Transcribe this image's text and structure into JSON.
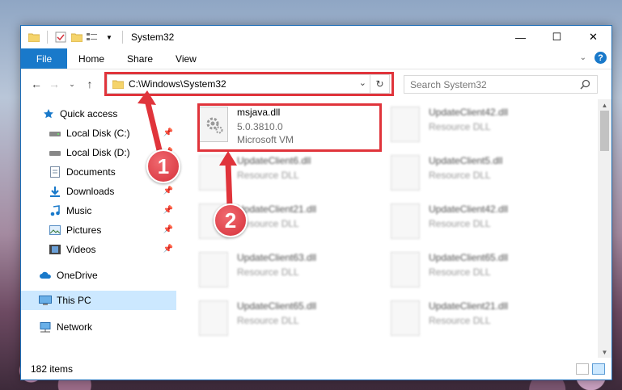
{
  "window": {
    "title": "System32",
    "controls": {
      "minimize": "—",
      "maximize": "☐",
      "close": "✕"
    }
  },
  "ribbon": {
    "file": "File",
    "tabs": [
      "Home",
      "Share",
      "View"
    ]
  },
  "address": {
    "path": "C:\\Windows\\System32",
    "search_placeholder": "Search System32"
  },
  "sidebar": {
    "items": [
      {
        "label": "Quick access",
        "icon": "star-icon"
      },
      {
        "label": "Local Disk (C:)",
        "icon": "drive-icon",
        "pinned": true
      },
      {
        "label": "Local Disk (D:)",
        "icon": "drive-icon",
        "pinned": true
      },
      {
        "label": "Documents",
        "icon": "documents-icon",
        "pinned": true
      },
      {
        "label": "Downloads",
        "icon": "downloads-icon",
        "pinned": true
      },
      {
        "label": "Music",
        "icon": "music-icon",
        "pinned": true
      },
      {
        "label": "Pictures",
        "icon": "pictures-icon",
        "pinned": true
      },
      {
        "label": "Videos",
        "icon": "videos-icon",
        "pinned": true
      },
      {
        "label": "OneDrive",
        "icon": "cloud-icon"
      },
      {
        "label": "This PC",
        "icon": "computer-icon",
        "selected": true
      },
      {
        "label": "Network",
        "icon": "network-icon"
      }
    ]
  },
  "files": [
    {
      "name": "msjava.dll",
      "line2": "5.0.3810.0",
      "line3": "Microsoft VM"
    },
    {
      "name": "UpdateClient42.dll",
      "line2": "Resource DLL"
    },
    {
      "name": "UpdateClient6.dll",
      "line2": "Resource DLL"
    },
    {
      "name": "UpdateClient5.dll",
      "line2": "Resource DLL"
    },
    {
      "name": "UpdateClient21.dll",
      "line2": "Resource DLL"
    },
    {
      "name": "UpdateClient42.dll",
      "line2": "Resource DLL"
    },
    {
      "name": "UpdateClient63.dll",
      "line2": "Resource DLL"
    },
    {
      "name": "UpdateClient65.dll",
      "line2": "Resource DLL"
    },
    {
      "name": "UpdateClient65.dll",
      "line2": "Resource DLL"
    },
    {
      "name": "UpdateClient21.dll",
      "line2": "Resource DLL"
    }
  ],
  "status": {
    "count": "182 items"
  },
  "callouts": {
    "one": "1",
    "two": "2"
  },
  "colors": {
    "highlight": "#e0343b",
    "accent": "#1979ca"
  }
}
